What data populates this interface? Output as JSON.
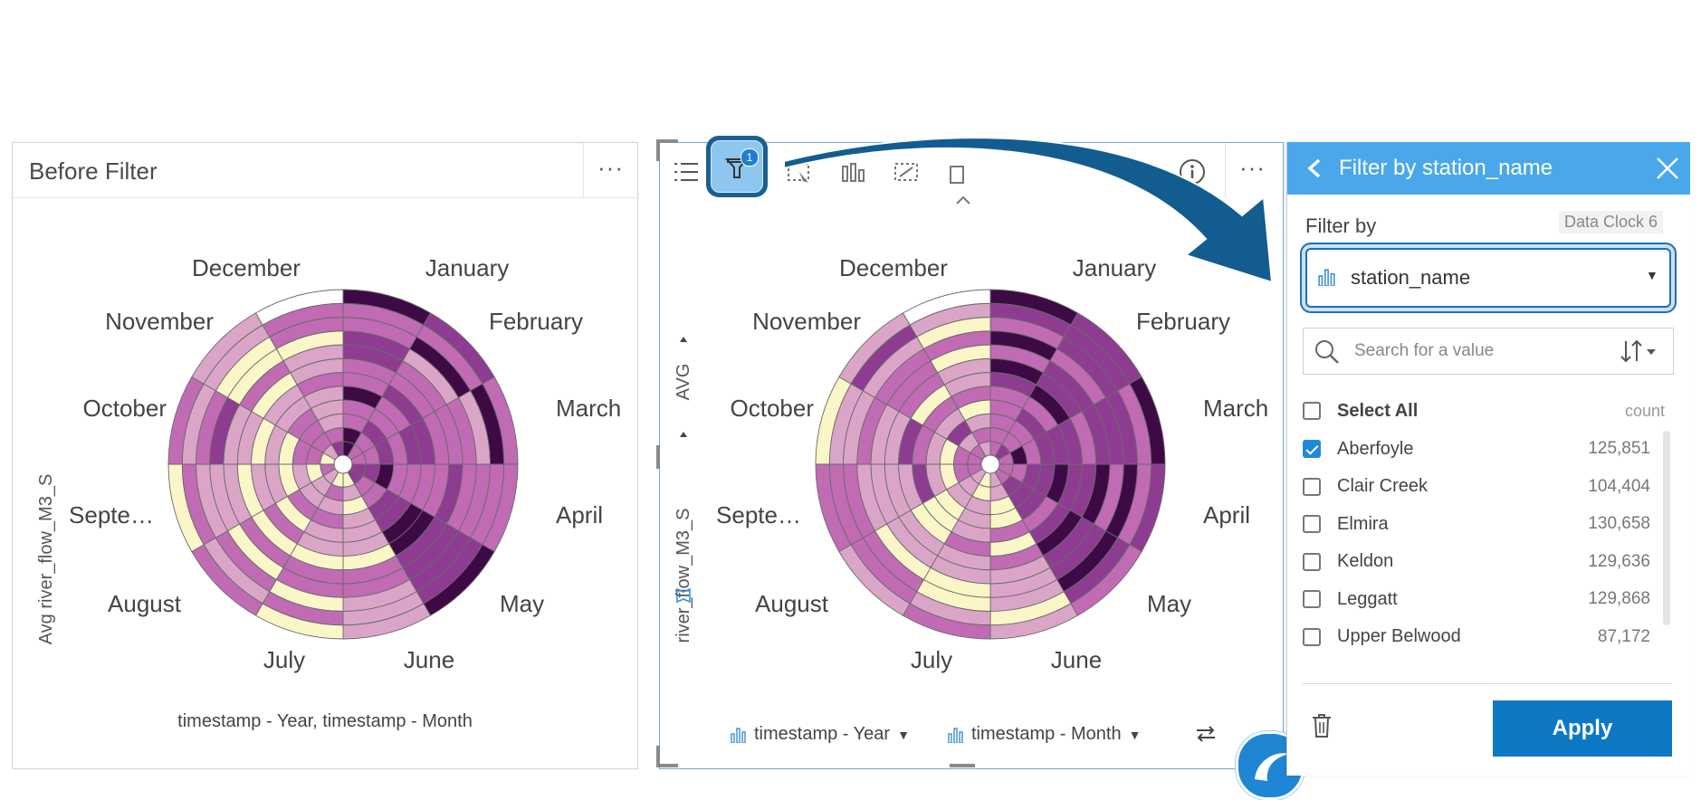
{
  "left_card": {
    "title": "Before Filter",
    "menu": "···",
    "y_axis": "Avg river_flow_M3_S",
    "x_axis": "timestamp - Year, timestamp - Month"
  },
  "right_card": {
    "y_axis_top": "AVG",
    "y_axis_field": "river_flow_M3_S",
    "menu": "···",
    "filter_badge": "1",
    "axis_pills": [
      "timestamp - Year",
      "timestamp - Month"
    ]
  },
  "months": [
    "December",
    "January",
    "November",
    "February",
    "October",
    "March",
    "Septe…",
    "April",
    "August",
    "May",
    "July",
    "June"
  ],
  "filter_panel": {
    "title": "Filter by station_name",
    "filter_by": "Filter by",
    "card_ref": "Data Clock 6",
    "field": "station_name",
    "search_placeholder": "Search for a value",
    "select_all": "Select All",
    "count_header": "count",
    "apply": "Apply",
    "items": [
      {
        "label": "Aberfoyle",
        "count": "125,851",
        "checked": true
      },
      {
        "label": "Clair Creek",
        "count": "104,404",
        "checked": false
      },
      {
        "label": "Elmira",
        "count": "130,658",
        "checked": false
      },
      {
        "label": "Keldon",
        "count": "129,636",
        "checked": false
      },
      {
        "label": "Leggatt",
        "count": "129,868",
        "checked": false
      },
      {
        "label": "Upper Belwood",
        "count": "87,172",
        "checked": false
      }
    ]
  },
  "colors": {
    "accent": "#4aa8ea",
    "apply": "#0d78c4",
    "arrow": "#135c8f",
    "heat_light": "#fbf6c8",
    "heat_pink": "#dba5c8",
    "heat_mid": "#c16bb5",
    "heat_purple": "#8e3c91",
    "heat_dark": "#3e0a45"
  }
}
